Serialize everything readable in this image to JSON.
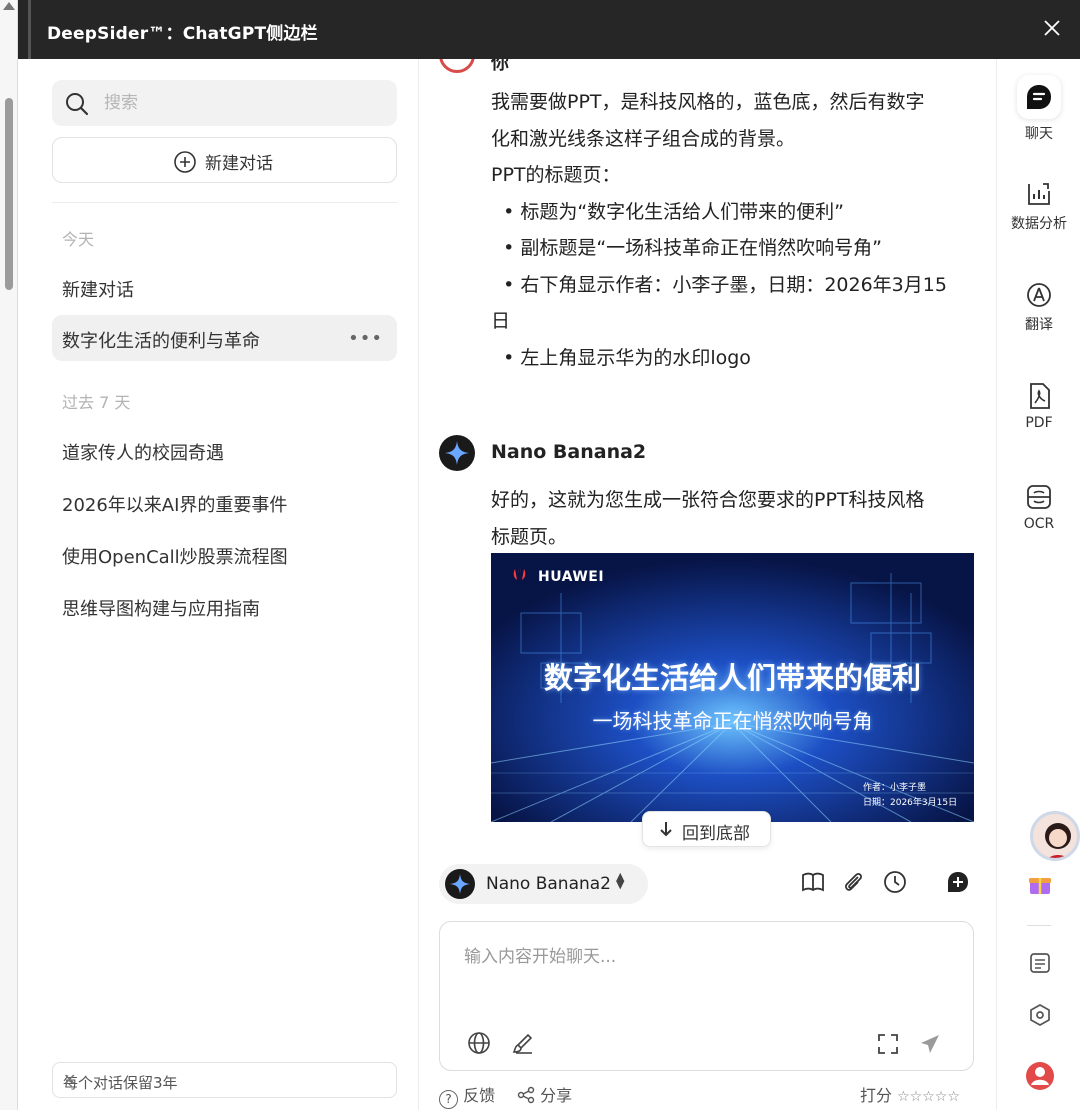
{
  "titlebar": {
    "title": "DeepSider™：ChatGPT侧边栏"
  },
  "sidebar": {
    "search_placeholder": "搜索",
    "new_chat_label": "新建对话",
    "groups": [
      {
        "label": "今天",
        "items": [
          {
            "title": "新建对话"
          },
          {
            "title": "数字化生活的便利与革命",
            "active": true
          }
        ]
      },
      {
        "label": "过去 7 天",
        "items": [
          {
            "title": "道家传人的校园奇遇"
          },
          {
            "title": "2026年以来AI界的重要事件"
          },
          {
            "title": "使用OpenCall炒股票流程图"
          },
          {
            "title": "思维导图构建与应用指南"
          }
        ]
      }
    ],
    "retention_notice": "每个对话保留3年"
  },
  "chat": {
    "user": {
      "name": "你",
      "lines": [
        "我需要做PPT，是科技风格的，蓝色底，然后有数字",
        "化和激光线条这样子组合成的背景。",
        "PPT的标题页：",
        "  • 标题为“数字化生活给人们带来的便利”",
        "  • 副标题是“一场科技革命正在悄然吹响号角”",
        "  • 右下角显示作者：小李子墨，日期：2026年3月15",
        "日",
        "  • 左上角显示华为的水印logo"
      ]
    },
    "bot": {
      "name": "Nano Banana2",
      "lines": [
        "好的，这就为您生成一张符合您要求的PPT科技风格",
        "标题页。"
      ],
      "image": {
        "brand": "HUAWEI",
        "headline": "数字化生活给人们带来的便利",
        "subline": "一场科技革命正在悄然吹响号角",
        "author": "作者：小李子墨",
        "date": "日期：2026年3月15日"
      }
    },
    "back_to_bottom": "回到底部",
    "model_selector": "Nano Banana2",
    "input_placeholder": "输入内容开始聊天...",
    "footer": {
      "feedback": "反馈",
      "share": "分享",
      "rate": "打分",
      "stars": "☆☆☆☆☆"
    }
  },
  "rail": {
    "items": [
      {
        "label": "聊天",
        "icon": "chat-icon"
      },
      {
        "label": "数据分析",
        "icon": "chart-icon"
      },
      {
        "label": "翻译",
        "icon": "translate-icon"
      },
      {
        "label": "PDF",
        "icon": "pdf-icon"
      },
      {
        "label": "OCR",
        "icon": "ocr-icon"
      }
    ]
  },
  "colors": {
    "titlebar": "#262626",
    "accent_red": "#e24a4a",
    "active_item": "#f0f0f0"
  }
}
